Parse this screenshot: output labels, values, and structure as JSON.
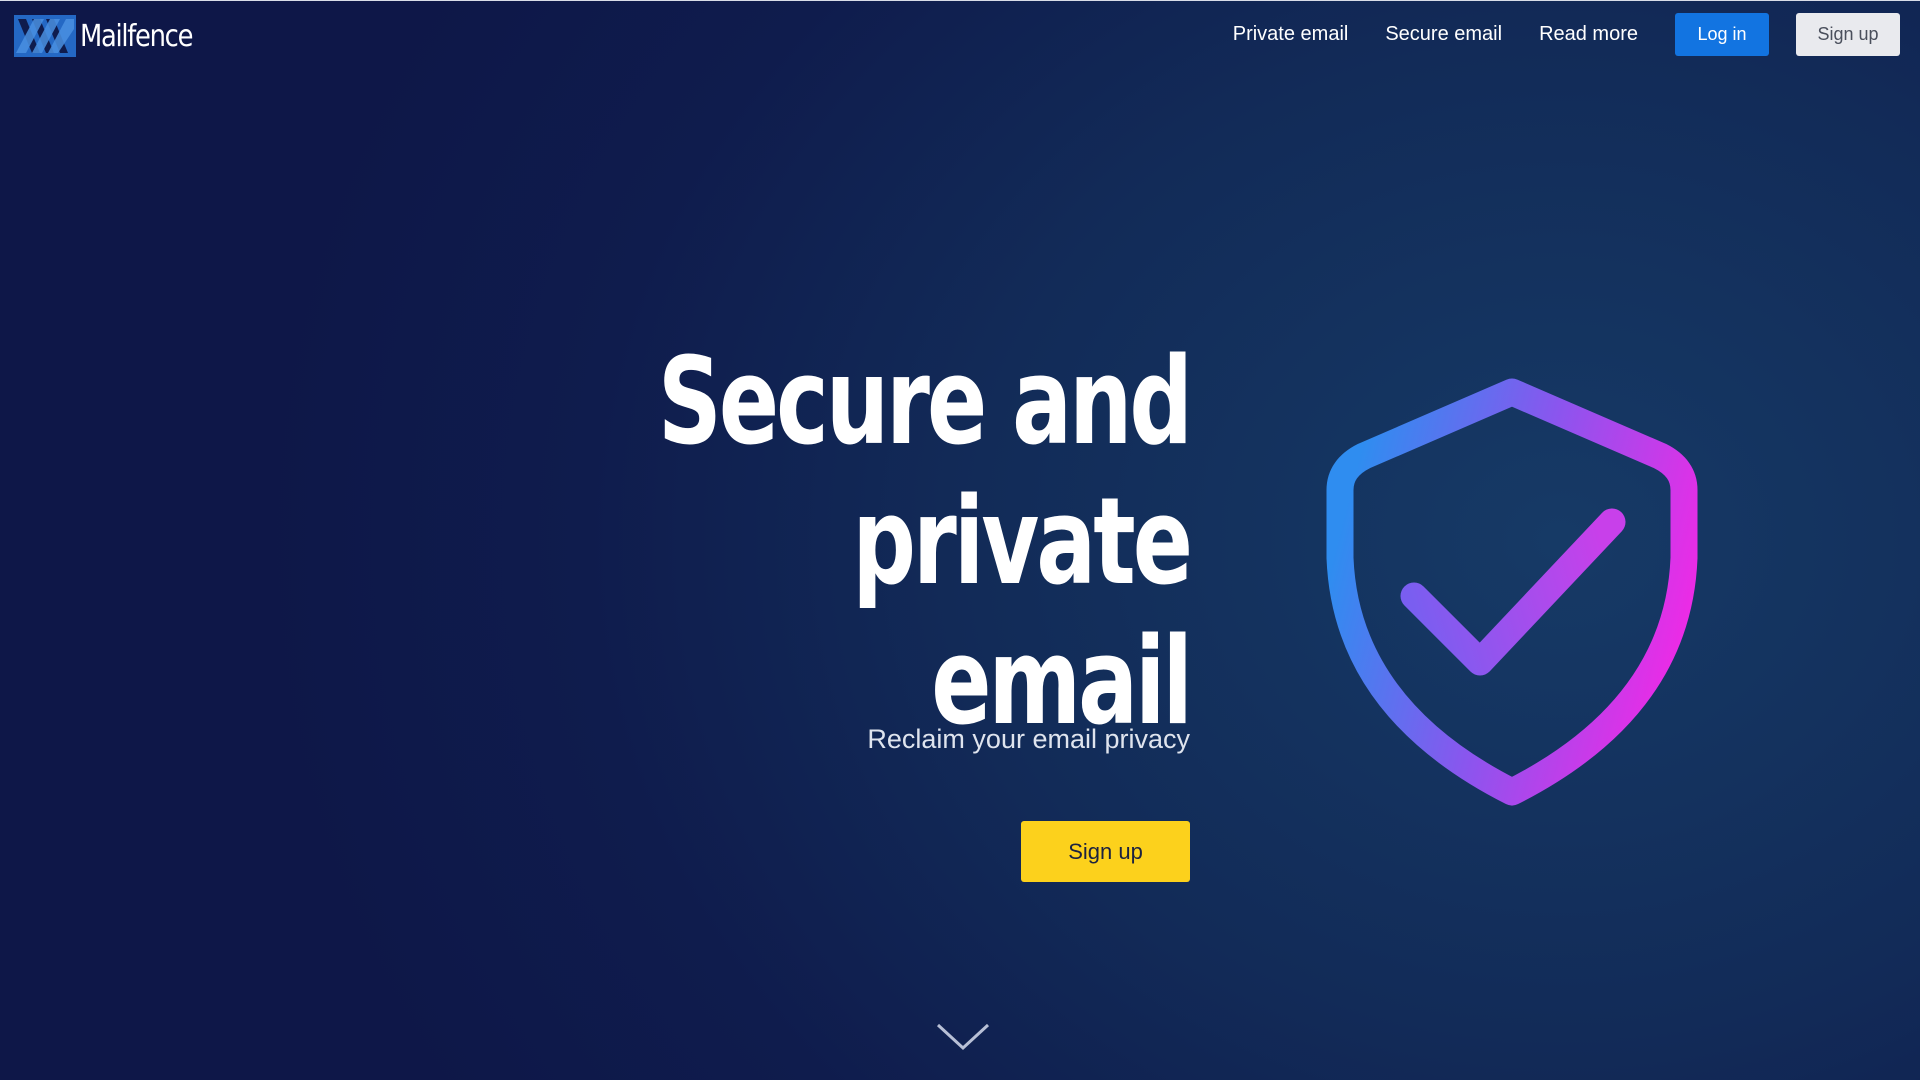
{
  "brand": {
    "name": "Mailfence",
    "logo_icon": "mailfence-logo-icon"
  },
  "nav": {
    "links": [
      {
        "label": "Private email"
      },
      {
        "label": "Secure email"
      },
      {
        "label": "Read more"
      }
    ],
    "login_label": "Log in",
    "signup_label": "Sign up"
  },
  "hero": {
    "title_line1": "Secure and private",
    "title_line2": "email",
    "subtitle": "Reclaim your email privacy",
    "cta_label": "Sign up",
    "illustration_icon": "shield-check-icon",
    "scroll_icon": "chevron-down-icon"
  },
  "colors": {
    "background": "#0f1c4d",
    "login_button": "#1274e1",
    "signup_top_button": "#e9eaee",
    "cta_button": "#fcd11c",
    "shield_gradient_start": "#2f8df0",
    "shield_gradient_mid": "#8b55ee",
    "shield_gradient_end": "#ee2ae6"
  }
}
